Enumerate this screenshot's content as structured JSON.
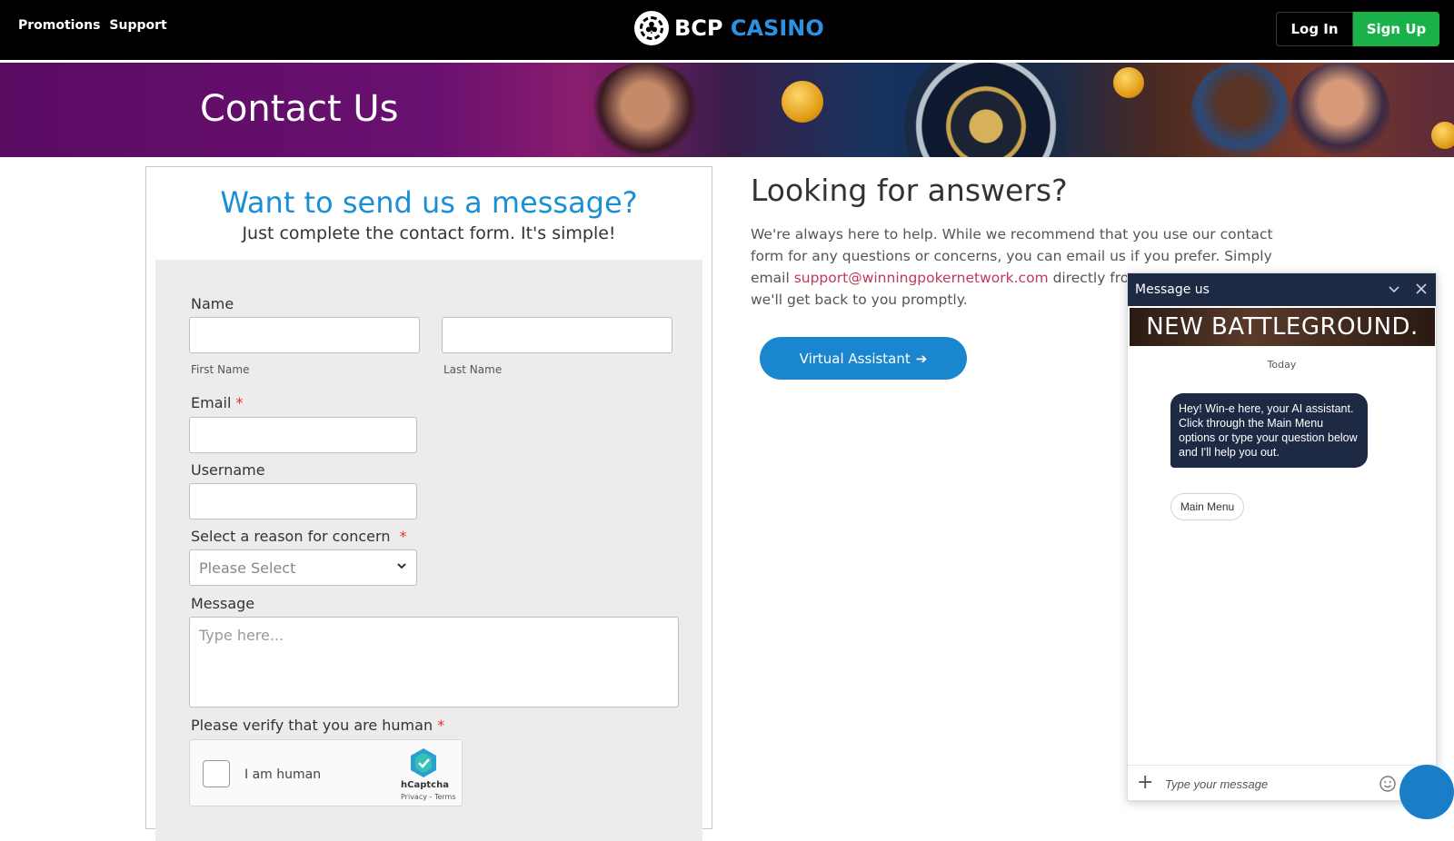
{
  "nav": {
    "promotions": "Promotions",
    "support": "Support",
    "brand_a": "BCP",
    "brand_b": "CASINO",
    "login": "Log In",
    "signup": "Sign Up"
  },
  "banner": {
    "title": "Contact Us"
  },
  "form": {
    "title": "Want to send us a message?",
    "subtitle": "Just complete the contact form. It's simple!",
    "name_label": "Name",
    "first_name_hint": "First Name",
    "last_name_hint": "Last Name",
    "first_name_value": "",
    "last_name_value": "",
    "email_label": "Email",
    "email_value": "",
    "username_label": "Username",
    "username_value": "",
    "reason_label": "Select a reason for concern",
    "reason_selected": "Please Select",
    "message_label": "Message",
    "message_placeholder": "Type here...",
    "verify_label": "Please verify that you are human",
    "required_mark": "*",
    "captcha_text": "I am human",
    "captcha_brand": "hCaptcha",
    "captcha_links": "Privacy - Terms"
  },
  "answers": {
    "title": "Looking for answers?",
    "text_before": "We're always here to help. While we recommend that you use our contact form for any questions or concerns, you can email us if you prefer. Simply email ",
    "email": "support@winningpokernetwork.com",
    "text_after": " directly from your",
    "text_end": "we'll get back to you promptly.",
    "va_button": "Virtual Assistant",
    "va_arrow": "➔"
  },
  "chat": {
    "header": "Message us",
    "banner": "NEW BATTLEGROUND.",
    "day": "Today",
    "bot_message": "Hey! Win-e here, your AI assistant. Click through the Main Menu options or type your question below and I'll help you out.",
    "main_menu": "Main Menu",
    "input_placeholder": "Type your message",
    "plus": "+"
  },
  "colors": {
    "accent_blue": "#1b8fd4",
    "signup_green": "#19b24a",
    "chat_navy": "#1e2a44",
    "link_pink": "#c03a5a"
  }
}
